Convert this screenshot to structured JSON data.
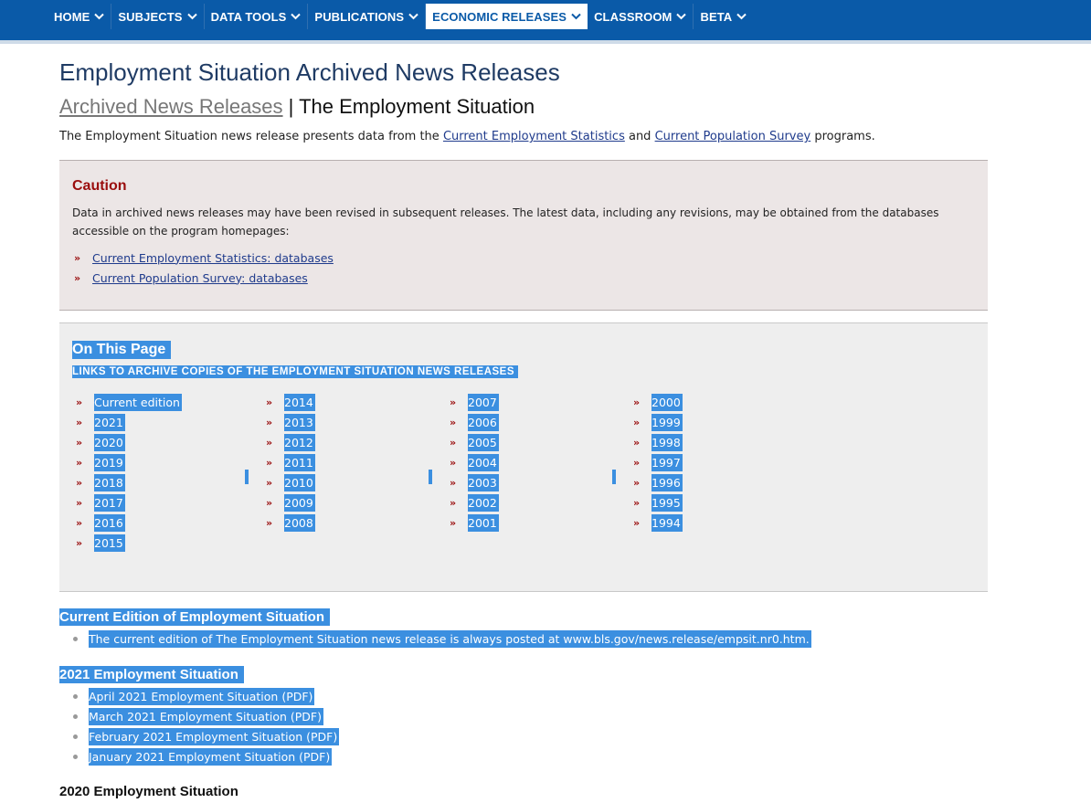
{
  "nav": {
    "items": [
      {
        "label": "HOME",
        "active": false
      },
      {
        "label": "SUBJECTS",
        "active": false
      },
      {
        "label": "DATA TOOLS",
        "active": false
      },
      {
        "label": "PUBLICATIONS",
        "active": false
      },
      {
        "label": "ECONOMIC RELEASES",
        "active": true
      },
      {
        "label": "CLASSROOM",
        "active": false
      },
      {
        "label": "BETA",
        "active": false
      }
    ]
  },
  "page": {
    "title": "Employment Situation Archived News Releases",
    "subtitle_link": "Archived News Releases",
    "subtitle_sep": " | ",
    "subtitle_rest": "The Employment Situation",
    "intro_pre": "The Employment Situation news release presents data from the ",
    "intro_link1": "Current Employment Statistics",
    "intro_mid": " and ",
    "intro_link2": "Current Population Survey",
    "intro_post": " programs."
  },
  "caution": {
    "title": "Caution",
    "text": "Data in archived news releases may have been revised in subsequent releases. The latest data, including any revisions, may be obtained from the databases accessible on the program homepages:",
    "links": [
      "Current Employment Statistics: databases",
      "Current Population Survey: databases"
    ]
  },
  "on_this_page": {
    "title": "On This Page",
    "subtitle": "LINKS TO ARCHIVE COPIES OF THE EMPLOYMENT SITUATION NEWS RELEASES",
    "columns": [
      [
        "Current edition",
        "2021",
        "2020",
        "2019",
        "2018",
        "2017",
        "2016",
        "2015"
      ],
      [
        "2014",
        "2013",
        "2012",
        "2011",
        "2010",
        "2009",
        "2008"
      ],
      [
        "2007",
        "2006",
        "2005",
        "2004",
        "2003",
        "2002",
        "2001"
      ],
      [
        "2000",
        "1999",
        "1998",
        "1997",
        "1996",
        "1995",
        "1994"
      ]
    ]
  },
  "sections": {
    "current": {
      "heading": "Current Edition of Employment Situation",
      "items": [
        "The current edition of The Employment Situation news release is always posted at www.bls.gov/news.release/empsit.nr0.htm."
      ]
    },
    "y2021": {
      "heading": "2021 Employment Situation",
      "items": [
        "April 2021 Employment Situation (PDF)",
        "March 2021 Employment Situation (PDF)",
        "February 2021 Employment Situation (PDF)",
        "January 2021 Employment Situation (PDF)"
      ]
    },
    "y2020": {
      "heading": "2020 Employment Situation"
    }
  },
  "colors": {
    "nav_bg": "#0a5aa8",
    "caution_title": "#9a0d0d",
    "selection": "#3b8fe0",
    "link": "#1f3b8c"
  }
}
